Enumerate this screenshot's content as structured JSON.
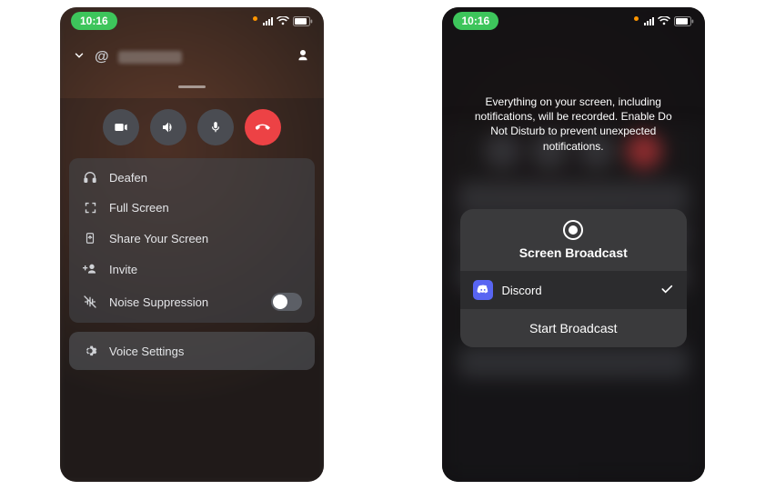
{
  "status": {
    "time": "10:16"
  },
  "phone1": {
    "channel_prefix": "@",
    "menu": {
      "deafen": "Deafen",
      "fullscreen": "Full Screen",
      "share": "Share Your Screen",
      "invite": "Invite",
      "noise": "Noise Suppression"
    },
    "voice_settings": "Voice Settings"
  },
  "phone2": {
    "broadcast_warning": "Everything on your screen, including notifications, will be recorded. Enable Do Not Disturb to prevent unexpected notifications.",
    "broadcast_title": "Screen Broadcast",
    "app_name": "Discord",
    "start_label": "Start Broadcast"
  }
}
